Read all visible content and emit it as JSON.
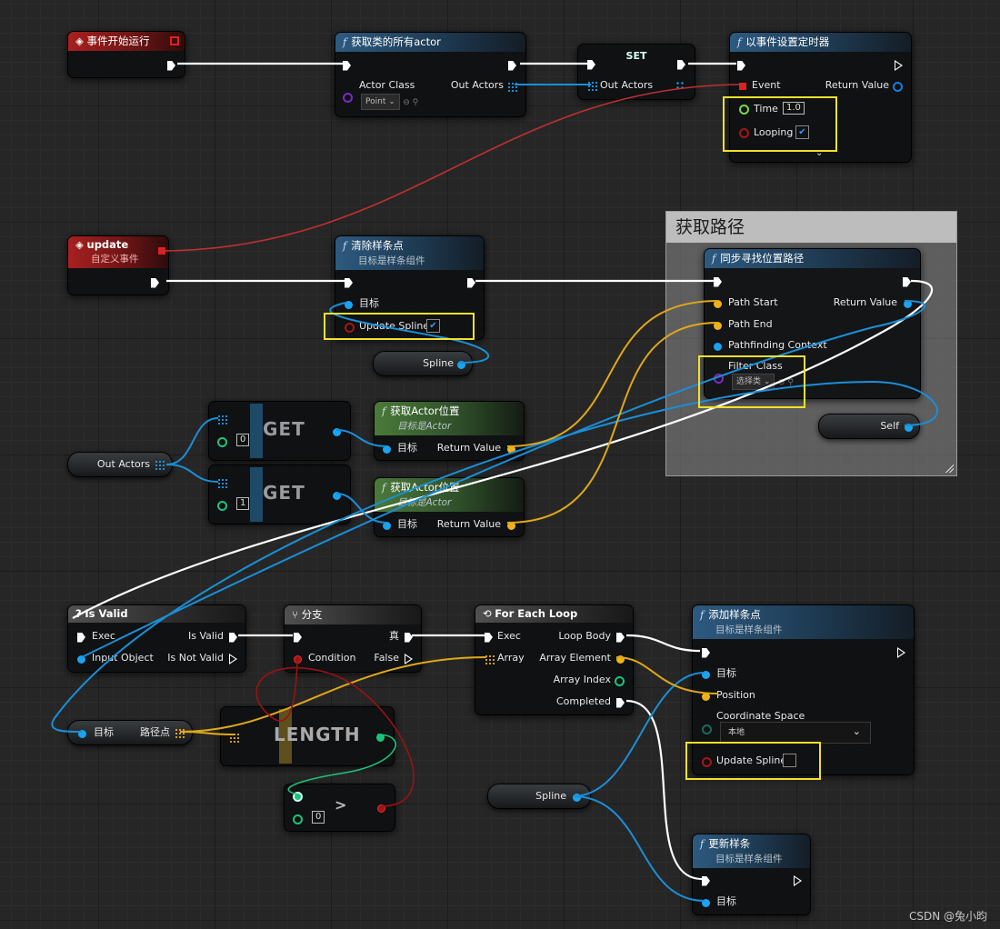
{
  "comment": {
    "title": "获取路径"
  },
  "nodes": {
    "begin_play": {
      "title": "事件开始运行"
    },
    "get_all_actors": {
      "title": "获取类的所有actor",
      "actor_class": "Actor Class",
      "class_value": "Point",
      "out_actors": "Out Actors"
    },
    "set": {
      "title": "SET",
      "out_actors": "Out Actors"
    },
    "set_timer": {
      "title": "以事件设置定时器",
      "event": "Event",
      "return_value": "Return Value",
      "time": "Time",
      "time_value": "1.0",
      "looping": "Looping",
      "check": "✔"
    },
    "update_event": {
      "title": "update",
      "subtitle": "自定义事件"
    },
    "clear_spline": {
      "title": "清除样条点",
      "subtitle": "目标是样条组件",
      "target": "目标",
      "update_spline": "Update Spline",
      "check": "✔"
    },
    "spline_var_top": {
      "label": "Spline"
    },
    "find_path": {
      "title": "同步寻找位置路径",
      "path_start": "Path Start",
      "path_end": "Path End",
      "pathfinding_context": "Pathfinding Context",
      "filter_class": "Filter Class",
      "filter_value": "选择类",
      "return_value": "Return Value"
    },
    "self_ref": {
      "label": "Self"
    },
    "out_actors_var": {
      "label": "Out Actors"
    },
    "get0": {
      "title": "GET",
      "index": "0"
    },
    "get1": {
      "title": "GET",
      "index": "1"
    },
    "get_loc0": {
      "title": "获取Actor位置",
      "subtitle": "目标是Actor",
      "target": "目标",
      "return_value": "Return Value"
    },
    "get_loc1": {
      "title": "获取Actor位置",
      "subtitle": "目标是Actor",
      "target": "目标",
      "return_value": "Return Value"
    },
    "is_valid": {
      "title": "Is Valid",
      "exec": "Exec",
      "is_valid": "Is Valid",
      "input_object": "Input Object",
      "is_not_valid": "Is Not Valid"
    },
    "branch": {
      "title": "分支",
      "true_label": "真",
      "condition": "Condition",
      "false_label": "False"
    },
    "for_each": {
      "title": "For Each Loop",
      "exec": "Exec",
      "loop_body": "Loop Body",
      "array": "Array",
      "array_element": "Array Element",
      "array_index": "Array Index",
      "completed": "Completed"
    },
    "add_spline_point": {
      "title": "添加样条点",
      "subtitle": "目标是样条组件",
      "target": "目标",
      "position": "Position",
      "coordinate_space": "Coordinate Space",
      "space_value": "本地",
      "update_spline": "Update Spline"
    },
    "path_points": {
      "target": "目标",
      "points": "路径点"
    },
    "length": {
      "title": "LENGTH"
    },
    "greater": {
      "symbol": ">",
      "value": "0"
    },
    "spline_var_bottom": {
      "label": "Spline"
    },
    "update_spline_node": {
      "title": "更新样条",
      "subtitle": "目标是样条组件",
      "target": "目标"
    }
  },
  "watermark": "CSDN @兔小昀",
  "colors": {
    "exec": "#ffffff",
    "object": "#1aa3f0",
    "vector": "#f0b21a",
    "bool": "#a51616",
    "delegate": "#c03030",
    "int": "#1cc47a",
    "highlight": "#f2e12a"
  }
}
